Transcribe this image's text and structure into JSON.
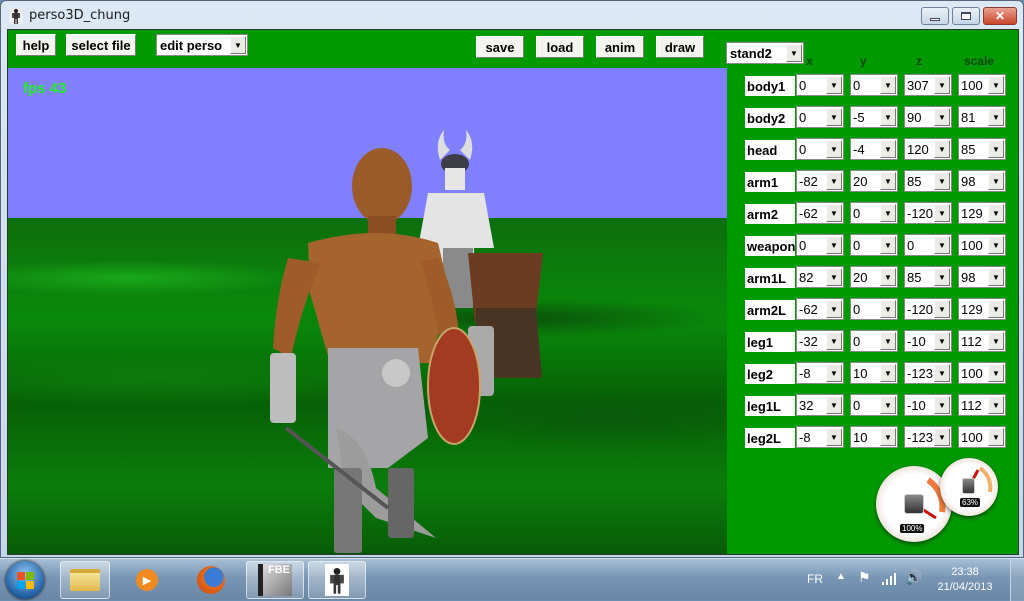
{
  "window": {
    "title": "perso3D_chung",
    "icon": "character-figure-icon",
    "controls": {
      "minimize": "minimize-icon",
      "maximize": "maximize-icon",
      "close": "close-icon"
    }
  },
  "toolbar": {
    "help_label": "help",
    "select_file_label": "select file",
    "mode_select_value": "edit perso",
    "save_label": "save",
    "load_label": "load",
    "anim_label": "anim",
    "draw_label": "draw",
    "anim_select_value": "stand2"
  },
  "viewport": {
    "fps_text": "fps 43",
    "sky_color": "#8080ff",
    "ground_color": "#0a7a0a"
  },
  "parts_table": {
    "columns": [
      "x",
      "y",
      "z",
      "scale"
    ],
    "rows": [
      {
        "name": "body1",
        "x": "0",
        "y": "0",
        "z": "307",
        "scale": "100"
      },
      {
        "name": "body2",
        "x": "0",
        "y": "-5",
        "z": "90",
        "scale": "81"
      },
      {
        "name": "head",
        "x": "0",
        "y": "-4",
        "z": "120",
        "scale": "85"
      },
      {
        "name": "arm1",
        "x": "-82",
        "y": "20",
        "z": "85",
        "scale": "98"
      },
      {
        "name": "arm2",
        "x": "-62",
        "y": "0",
        "z": "-120",
        "scale": "129"
      },
      {
        "name": "weapon",
        "x": "0",
        "y": "0",
        "z": "0",
        "scale": "100"
      },
      {
        "name": "arm1L",
        "x": "82",
        "y": "20",
        "z": "85",
        "scale": "98"
      },
      {
        "name": "arm2L",
        "x": "-62",
        "y": "0",
        "z": "-120",
        "scale": "129"
      },
      {
        "name": "leg1",
        "x": "-32",
        "y": "0",
        "z": "-10",
        "scale": "112"
      },
      {
        "name": "leg2",
        "x": "-8",
        "y": "10",
        "z": "-123",
        "scale": "100"
      },
      {
        "name": "leg1L",
        "x": "32",
        "y": "0",
        "z": "-10",
        "scale": "112"
      },
      {
        "name": "leg2L",
        "x": "-8",
        "y": "10",
        "z": "-123",
        "scale": "100"
      }
    ]
  },
  "gadget": {
    "cpu_label": "100%",
    "memory_label": "63%",
    "cpu_percent": 100,
    "memory_percent": 63
  },
  "taskbar": {
    "items": [
      {
        "name": "start-button",
        "icon": "windows-logo-icon"
      },
      {
        "name": "explorer",
        "icon": "folder-icon"
      },
      {
        "name": "media-player",
        "icon": "play-icon"
      },
      {
        "name": "firefox",
        "icon": "firefox-icon"
      },
      {
        "name": "fbe",
        "icon": "fbe-icon",
        "label": "FBE"
      },
      {
        "name": "perso3d",
        "icon": "character-figure-icon"
      }
    ],
    "language": "FR",
    "tray_icons": [
      "show-hidden-icon",
      "action-center-flag-icon",
      "network-signal-icon",
      "volume-icon"
    ],
    "time": "23:38",
    "date": "21/04/2013"
  }
}
